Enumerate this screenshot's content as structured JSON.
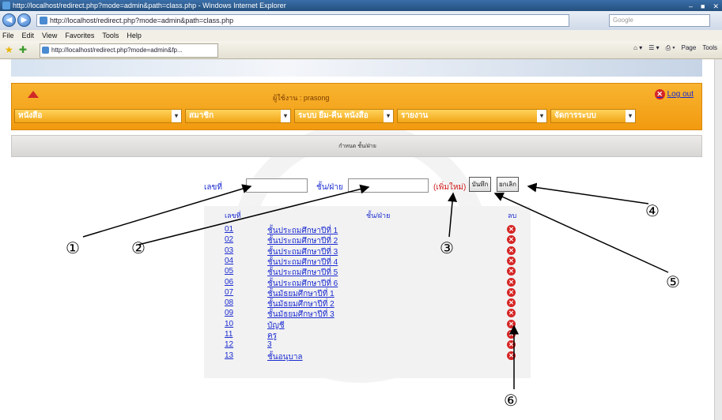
{
  "browser": {
    "title": "http://localhost/redirect.php?mode=admin&path=class.php - Windows Internet Explorer",
    "address": "http://localhost/redirect.php?mode=admin&path=class.php",
    "search_placeholder": "Google",
    "menu": [
      "File",
      "Edit",
      "View",
      "Favorites",
      "Tools",
      "Help"
    ],
    "tab_label": "http://localhost/redirect.php?mode=admin&fp...",
    "commands": [
      "Page",
      "Tools"
    ]
  },
  "header": {
    "user_label": "ผู้ใช้งาน : prasong",
    "logout_label": "Log out"
  },
  "menubar": [
    {
      "label": "หนังสือ"
    },
    {
      "label": "สมาชิก"
    },
    {
      "label": "ระบบ ยืม-คืน หนังสือ"
    },
    {
      "label": "รายงาน"
    },
    {
      "label": "จัดการระบบ"
    }
  ],
  "section_title": "กำหนด ชั้น/ฝ่าย",
  "form": {
    "number_label": "เลขที่",
    "class_label": "ชั้น/ฝ่าย",
    "add_new_label": "(เพิ่มใหม่)",
    "save_button": "บันทึก",
    "cancel_button": "ยกเลิก"
  },
  "table": {
    "columns": [
      "เลขที่",
      "ชั้น/ฝ่าย",
      "ลบ"
    ],
    "rows": [
      {
        "code": "01",
        "name": "ชั้นประถมศึกษาปีที่ 1"
      },
      {
        "code": "02",
        "name": "ชั้นประถมศึกษาปีที่ 2"
      },
      {
        "code": "03",
        "name": "ชั้นประถมศึกษาปีที่ 3"
      },
      {
        "code": "04",
        "name": "ชั้นประถมศึกษาปีที่ 4"
      },
      {
        "code": "05",
        "name": "ชั้นประถมศึกษาปีที่ 5"
      },
      {
        "code": "06",
        "name": "ชั้นประถมศึกษาปีที่ 6"
      },
      {
        "code": "07",
        "name": "ชั้นมัธยมศึกษาปีที่ 1"
      },
      {
        "code": "08",
        "name": "ชั้นมัธยมศึกษาปีที่ 2"
      },
      {
        "code": "09",
        "name": "ชั้นมัธยมศึกษาปีที่ 3"
      },
      {
        "code": "10",
        "name": "บัญชี"
      },
      {
        "code": "11",
        "name": "ครู"
      },
      {
        "code": "12",
        "name": "3"
      },
      {
        "code": "13",
        "name": "ชั้นอนุบาล"
      }
    ]
  },
  "callouts": [
    "①",
    "②",
    "③",
    "④",
    "⑤",
    "⑥"
  ]
}
